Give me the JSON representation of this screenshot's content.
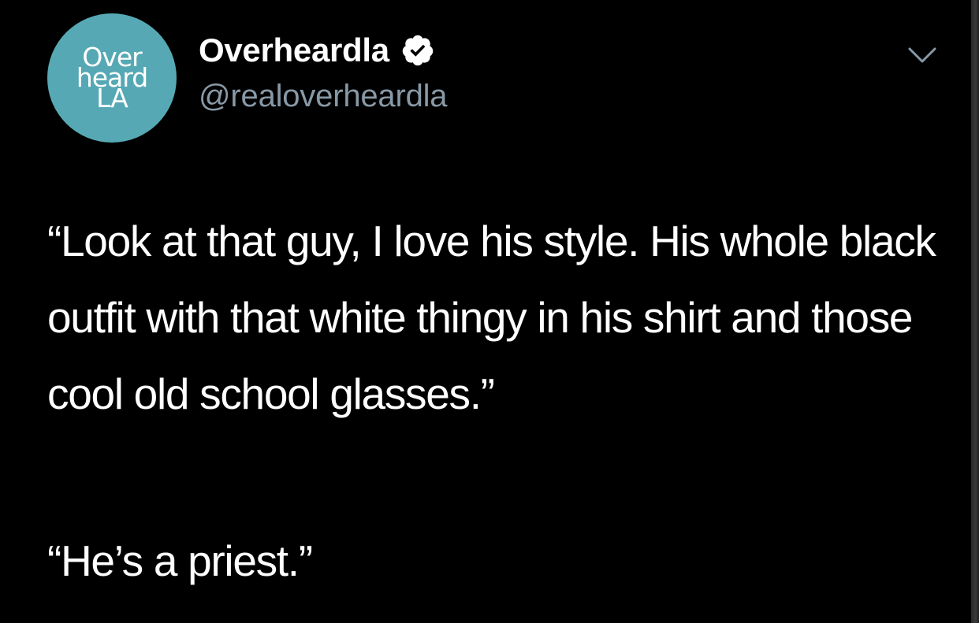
{
  "account": {
    "avatar_lines": [
      "Over",
      "heard",
      "LA"
    ],
    "display_name": "Overheardla",
    "handle": "@realoverheardla",
    "verified_icon": "verified-badge-icon",
    "menu_icon": "chevron-down-icon"
  },
  "tweet": {
    "paragraph_1": "“Look at that guy, I love his style. His whole black outfit with that white thingy in his shirt and those cool old school glasses.”",
    "paragraph_2": "“He’s a priest.”"
  },
  "colors": {
    "background": "#000000",
    "text": "#ffffff",
    "handle": "#8899a6",
    "avatar_bg": "#56a9b4",
    "chevron": "#8899a6"
  }
}
